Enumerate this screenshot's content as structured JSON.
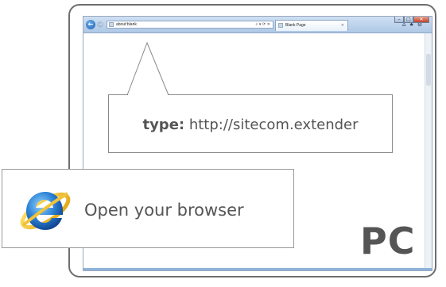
{
  "browser": {
    "address_text": "about:blank",
    "address_tools": "⌕ ▾ ⟳ ✕",
    "tab_title": "Blank Page",
    "tab_close": "×",
    "nav_back": "←",
    "nav_forward": "→",
    "tool_icons": "⌂★⚙",
    "controls": {
      "minimize": "–",
      "maximize": "□",
      "close": "✕"
    }
  },
  "callout": {
    "prefix": "type:",
    "url": "http://sitecom.extender"
  },
  "ie_card": {
    "label": "Open your browser",
    "logo_icon": "internet-explorer-icon"
  },
  "device_label": "PC"
}
